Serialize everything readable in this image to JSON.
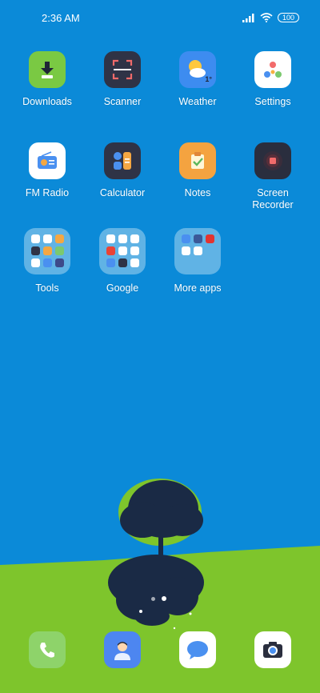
{
  "status_bar": {
    "time": "2:36 AM",
    "battery": "100"
  },
  "apps": [
    {
      "label": "Downloads",
      "icon": "download-icon",
      "color": "#7ac943"
    },
    {
      "label": "Scanner",
      "icon": "scanner-icon",
      "color": "#2f3346"
    },
    {
      "label": "Weather",
      "icon": "weather-icon",
      "color": "#3d8cf0",
      "badge": "1°"
    },
    {
      "label": "Settings",
      "icon": "settings-icon",
      "color": "#ffffff"
    },
    {
      "label": "FM Radio",
      "icon": "radio-icon",
      "color": "#ffffff"
    },
    {
      "label": "Calculator",
      "icon": "calculator-icon",
      "color": "#2f3346"
    },
    {
      "label": "Notes",
      "icon": "notes-icon",
      "color": "#f4a340"
    },
    {
      "label": "Screen\nRecorder",
      "icon": "screen-recorder-icon",
      "color": "#2a2e3e"
    }
  ],
  "folders": [
    {
      "label": "Tools"
    },
    {
      "label": "Google"
    },
    {
      "label": "More apps"
    }
  ],
  "dock": [
    {
      "name": "phone",
      "icon": "phone-icon",
      "color": "#8ed36a"
    },
    {
      "name": "contacts",
      "icon": "contacts-icon",
      "color": "#4d86f0"
    },
    {
      "name": "messages",
      "icon": "messages-icon",
      "color": "#ffffff"
    },
    {
      "name": "camera",
      "icon": "camera-icon",
      "color": "#ffffff"
    }
  ],
  "page_indicator": {
    "pages": 2,
    "current": 2
  }
}
